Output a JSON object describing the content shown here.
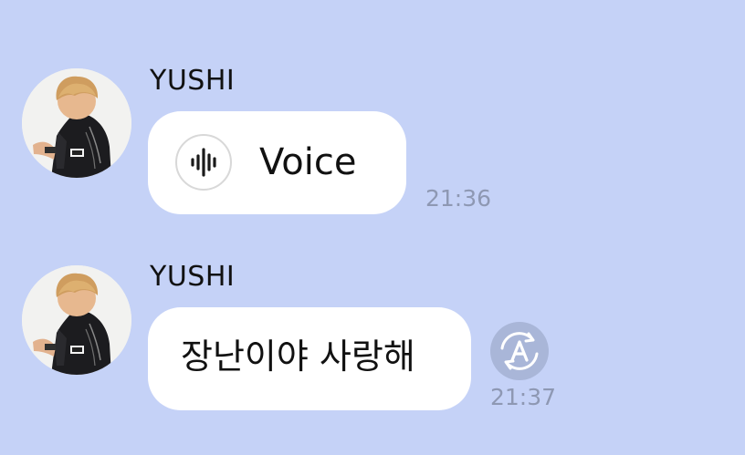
{
  "messages": [
    {
      "sender": "YUSHI",
      "type": "voice",
      "label": "Voice",
      "time": "21:36",
      "icon": "voice-waveform-icon"
    },
    {
      "sender": "YUSHI",
      "type": "text",
      "text": "장난이야 사랑해",
      "time": "21:37",
      "action_icon": "translate-icon"
    }
  ],
  "colors": {
    "background": "#c5d2f7",
    "bubble": "#ffffff",
    "timestamp": "#8e98b3",
    "translate_button": "#a9b6d8"
  }
}
